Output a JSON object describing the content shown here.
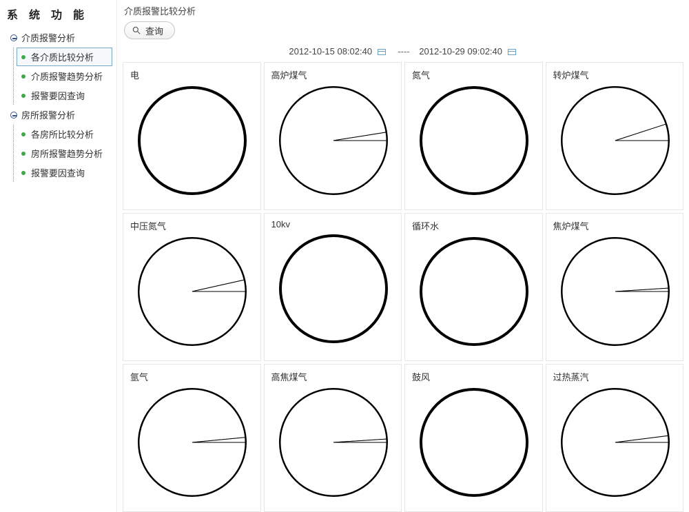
{
  "sidebar": {
    "title": "系 统 功 能",
    "groups": [
      {
        "label": "介质报警分析",
        "items": [
          {
            "label": "各介质比较分析",
            "selected": true
          },
          {
            "label": "介质报警趋势分析"
          },
          {
            "label": "报警要因查询"
          }
        ]
      },
      {
        "label": "房所报警分析",
        "items": [
          {
            "label": "各房所比较分析"
          },
          {
            "label": "房所报警趋势分析"
          },
          {
            "label": "报警要因查询"
          }
        ]
      }
    ]
  },
  "page": {
    "title": "介质报警比较分析",
    "query_label": "查询",
    "date_from": "2012-10-15 08:02:40",
    "date_sep": "----",
    "date_to": "2012-10-29 09:02:40"
  },
  "chart_data": [
    {
      "type": "pie",
      "title": "电",
      "slices": [
        {
          "value": 100
        }
      ]
    },
    {
      "type": "pie",
      "title": "高炉煤气",
      "slices": [
        {
          "value": 97.5
        },
        {
          "value": 2.5
        }
      ]
    },
    {
      "type": "pie",
      "title": "氮气",
      "slices": [
        {
          "value": 100
        }
      ]
    },
    {
      "type": "pie",
      "title": "转炉煤气",
      "slices": [
        {
          "value": 95
        },
        {
          "value": 5
        }
      ]
    },
    {
      "type": "pie",
      "title": "中压氮气",
      "slices": [
        {
          "value": 96.5
        },
        {
          "value": 3.5
        }
      ]
    },
    {
      "type": "pie",
      "title": "10kv",
      "slices": [
        {
          "value": 100
        }
      ]
    },
    {
      "type": "pie",
      "title": "循环水",
      "slices": [
        {
          "value": 100
        }
      ]
    },
    {
      "type": "pie",
      "title": "焦炉煤气",
      "slices": [
        {
          "value": 99
        },
        {
          "value": 1
        }
      ]
    },
    {
      "type": "pie",
      "title": "氩气",
      "slices": [
        {
          "value": 98.5
        },
        {
          "value": 1.5
        }
      ]
    },
    {
      "type": "pie",
      "title": "高焦煤气",
      "slices": [
        {
          "value": 99
        },
        {
          "value": 1
        }
      ]
    },
    {
      "type": "pie",
      "title": "鼓风",
      "slices": [
        {
          "value": 100
        }
      ]
    },
    {
      "type": "pie",
      "title": "过热蒸汽",
      "slices": [
        {
          "value": 98
        },
        {
          "value": 2
        }
      ]
    }
  ]
}
